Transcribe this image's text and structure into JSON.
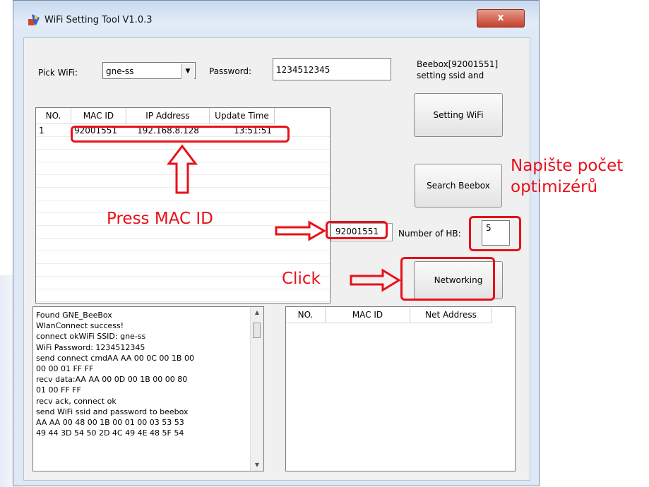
{
  "window": {
    "title": "WiFi Setting Tool V1.0.3",
    "close_label": "x"
  },
  "form": {
    "pick_wifi_label": "Pick WiFi:",
    "pick_wifi_value": "gne-ss",
    "password_label": "Password:",
    "password_value": "1234512345",
    "info_line1": "Beebox[92001551]",
    "info_line2": "setting ssid and",
    "number_of_hb_label": "Number of HB:",
    "number_of_hb_value": "5",
    "selected_mac_id": "92001551"
  },
  "buttons": {
    "setting_wifi": "Setting WiFi",
    "search_beebox": "Search Beebox",
    "networking": "Networking"
  },
  "device_table": {
    "columns": [
      "NO.",
      "MAC ID",
      "IP Address",
      "Update Time"
    ],
    "rows": [
      {
        "no": "1",
        "mac": "92001551",
        "ip": "192.168.8.128",
        "time": "13:51:51"
      }
    ]
  },
  "net_table": {
    "columns": [
      "NO.",
      "MAC ID",
      "Net Address"
    ]
  },
  "log": {
    "lines": [
      "Found GNE_BeeBox",
      "WlanConnect success!",
      "connect okWiFi SSID: gne-ss",
      "WiFi Password: 1234512345",
      "send connect cmdAA AA 00 0C 00 1B 00",
      "00 00 01 FF FF",
      "recv data:AA AA 00 0D 00 1B 00 00 80",
      "01 00 FF FF",
      "recv ack, connect ok",
      "send WiFi ssid and password to beebox",
      "AA AA 00 48 00 1B 00 01 00 03 53 53",
      "49 44 3D 54 50 2D 4C 49 4E 48 5F 54"
    ]
  },
  "annotations": {
    "press_mac_id": "Press MAC ID",
    "click": "Click",
    "count_line1": "Napište počet",
    "count_line2": "optimizérů",
    "color": "#e8101a"
  }
}
